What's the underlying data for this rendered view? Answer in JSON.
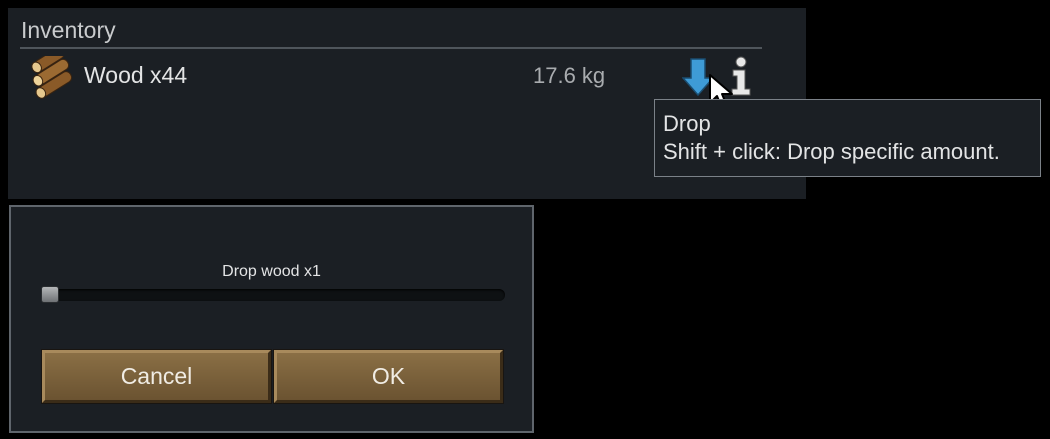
{
  "inventory": {
    "title": "Inventory",
    "item": {
      "name": "Wood x44",
      "mass": "17.6 kg",
      "icon": "wood-logs-icon"
    }
  },
  "tooltip": {
    "title": "Drop",
    "description": "Shift + click: Drop specific amount."
  },
  "dialog": {
    "slider_label": "Drop wood x1",
    "slider_value": 1,
    "slider_max": 44,
    "cancel_label": "Cancel",
    "ok_label": "OK"
  },
  "colors": {
    "panel_bg": "#1b1f24",
    "drop_icon": "#3e9bd6",
    "button": "#7a6140"
  }
}
